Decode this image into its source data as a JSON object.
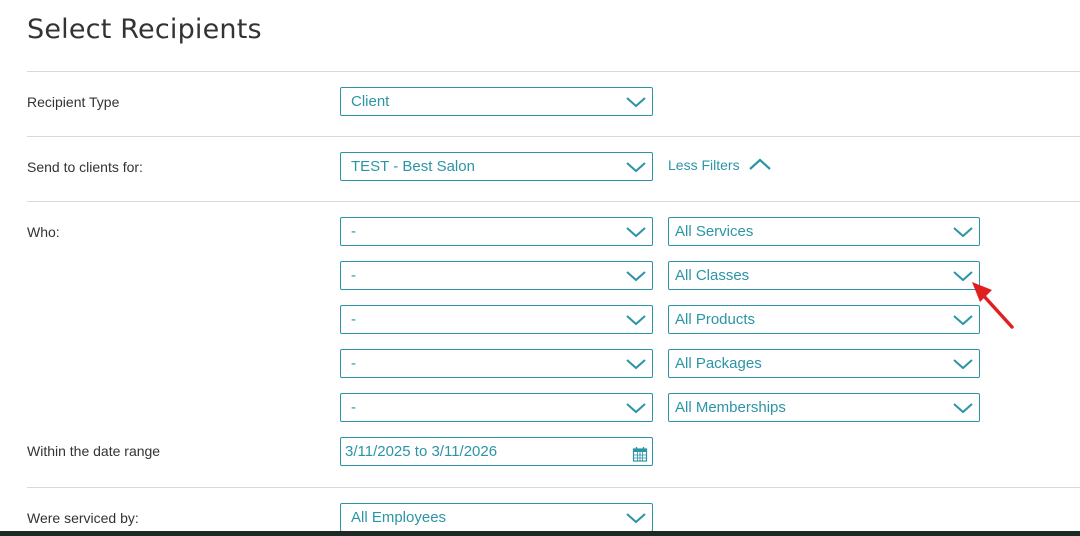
{
  "page": {
    "title": "Select Recipients"
  },
  "recipient_type": {
    "label": "Recipient Type",
    "value": "Client"
  },
  "send_to": {
    "label": "Send to clients for:",
    "value": "TEST - Best Salon",
    "filters_link": "Less Filters"
  },
  "who": {
    "label": "Who:",
    "filters": [
      {
        "qualifier": "-",
        "category": "All Services"
      },
      {
        "qualifier": "-",
        "category": "All Classes"
      },
      {
        "qualifier": "-",
        "category": "All Products"
      },
      {
        "qualifier": "-",
        "category": "All Packages"
      },
      {
        "qualifier": "-",
        "category": "All Memberships"
      }
    ]
  },
  "date_range": {
    "label": "Within the date range",
    "value": "3/11/2025 to 3/11/2026"
  },
  "serviced_by": {
    "label": "Were serviced by:",
    "value": "All Employees"
  },
  "colors": {
    "accent": "#2b95a6",
    "text": "#333333",
    "divider": "#d9d9d9",
    "annotation_arrow": "#e02020"
  },
  "icons": [
    "chevron-down-icon",
    "chevron-up-icon",
    "calendar-icon",
    "annotation-arrow-icon"
  ]
}
